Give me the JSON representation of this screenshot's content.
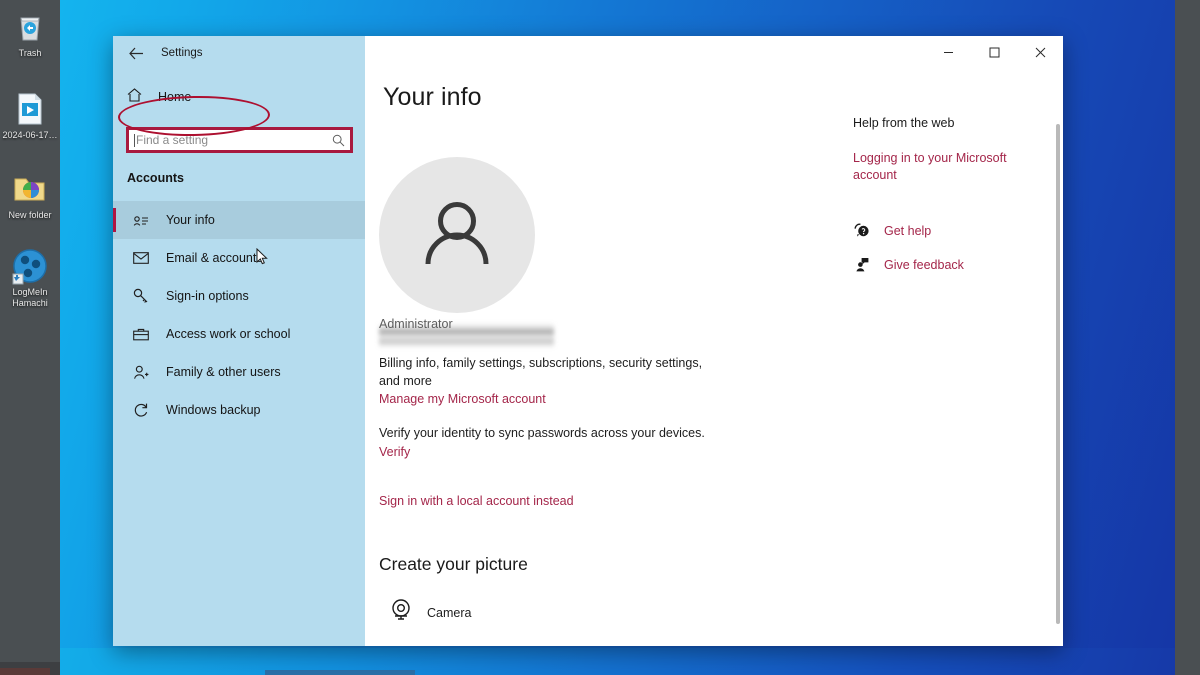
{
  "desktop": {
    "icons": [
      {
        "name": "trash-icon",
        "label": "Trash"
      },
      {
        "name": "video-file-icon",
        "label": "2024-06-17…"
      },
      {
        "name": "folder-icon",
        "label": "New folder"
      },
      {
        "name": "logmein-hamachi-icon",
        "label": "LogMeIn\nHamachi"
      }
    ]
  },
  "window": {
    "title": "Settings",
    "controls": {
      "minimize": "–",
      "maximize": "☐",
      "close": "✕"
    }
  },
  "sidebar": {
    "home_label": "Home",
    "search": {
      "placeholder": "Find a setting",
      "value": ""
    },
    "section_heading": "Accounts",
    "items": [
      {
        "label": "Your info",
        "icon": "id-card-icon",
        "selected": true
      },
      {
        "label": "Email & accounts",
        "icon": "envelope-icon",
        "selected": false
      },
      {
        "label": "Sign-in options",
        "icon": "key-icon",
        "selected": false
      },
      {
        "label": "Access work or school",
        "icon": "briefcase-icon",
        "selected": false
      },
      {
        "label": "Family & other users",
        "icon": "person-add-icon",
        "selected": false
      },
      {
        "label": "Windows backup",
        "icon": "refresh-icon",
        "selected": false
      }
    ],
    "annotation": {
      "type": "red-ellipse",
      "target": "Sign-in options",
      "color": "#ad1030"
    },
    "search_annotation_color": "#a81a3f"
  },
  "main": {
    "page_title": "Your info",
    "account_role": "Administrator",
    "billing_text": "Billing info, family settings, subscriptions, security settings, and more",
    "manage_link": "Manage my Microsoft account",
    "verify_text": "Verify your identity to sync passwords across your devices.",
    "verify_link": "Verify",
    "local_account_link": "Sign in with a local account instead",
    "create_picture_heading": "Create your picture",
    "camera_label": "Camera"
  },
  "help": {
    "heading": "Help from the web",
    "article_link": "Logging in to your Microsoft account",
    "actions": [
      {
        "label": "Get help",
        "icon": "question-bubble-icon"
      },
      {
        "label": "Give feedback",
        "icon": "feedback-person-icon"
      }
    ]
  },
  "colors": {
    "sidebar_bg": "#b5dcee",
    "selected_item_bg": "#a8ccdd",
    "accent_bar": "#b01442",
    "link": "#a4264a",
    "annotation_red": "#ad1030"
  }
}
